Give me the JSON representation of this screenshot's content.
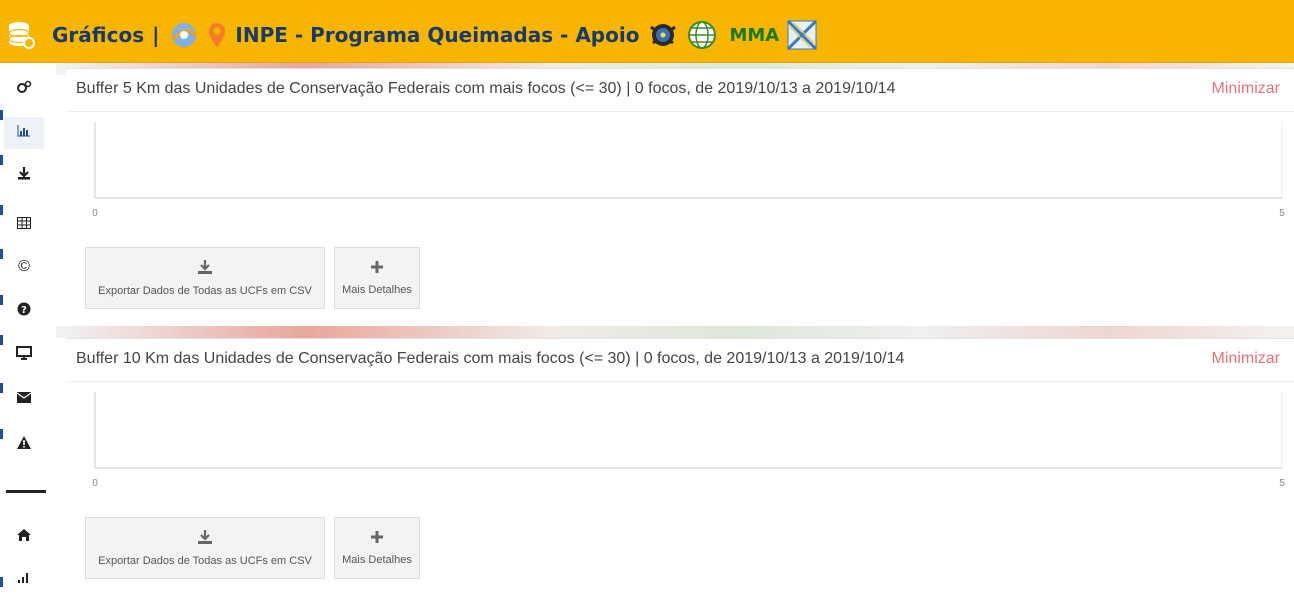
{
  "header": {
    "title_prefix": "Gráficos",
    "separator": "|",
    "program": "INPE - Programa Queimadas - Apoio",
    "mma": "MMA"
  },
  "sidebar": {
    "items": [
      {
        "icon": "settings-cogs-icon"
      },
      {
        "icon": "bar-chart-icon",
        "active": true
      },
      {
        "icon": "download-icon"
      },
      {
        "icon": "table-icon"
      },
      {
        "icon": "copyright-icon"
      },
      {
        "icon": "help-circle-icon"
      },
      {
        "icon": "monitor-icon"
      },
      {
        "icon": "envelope-icon"
      },
      {
        "icon": "warning-icon"
      },
      {
        "icon": "home-icon"
      },
      {
        "icon": "signal-icon"
      }
    ]
  },
  "panels": [
    {
      "title": "Buffer 5 Km das Unidades de Conservação Federais com mais focos (<= 30) | 0 focos, de 2019/10/13 a 2019/10/14",
      "minimize": "Minimizar",
      "chart_data": {
        "type": "bar",
        "categories": [],
        "values": [],
        "xlim": [
          0,
          5
        ],
        "x_ticks": [
          "0",
          "5"
        ]
      },
      "export_label": "Exportar Dados de Todas as UCFs em CSV",
      "details_label": "Mais Detalhes"
    },
    {
      "title": "Buffer 10 Km das Unidades de Conservação Federais com mais focos (<= 30) | 0 focos, de 2019/10/13 a 2019/10/14",
      "minimize": "Minimizar",
      "chart_data": {
        "type": "bar",
        "categories": [],
        "values": [],
        "xlim": [
          0,
          5
        ],
        "x_ticks": [
          "0",
          "5"
        ]
      },
      "export_label": "Exportar Dados de Todas as UCFs em CSV",
      "details_label": "Mais Detalhes"
    }
  ],
  "colors": {
    "header_bg": "#f7b500",
    "header_text": "#183a6b",
    "mma_text": "#1a7a1a",
    "minimize_text": "#e6737a",
    "active_accent": "#1f4f9a"
  }
}
